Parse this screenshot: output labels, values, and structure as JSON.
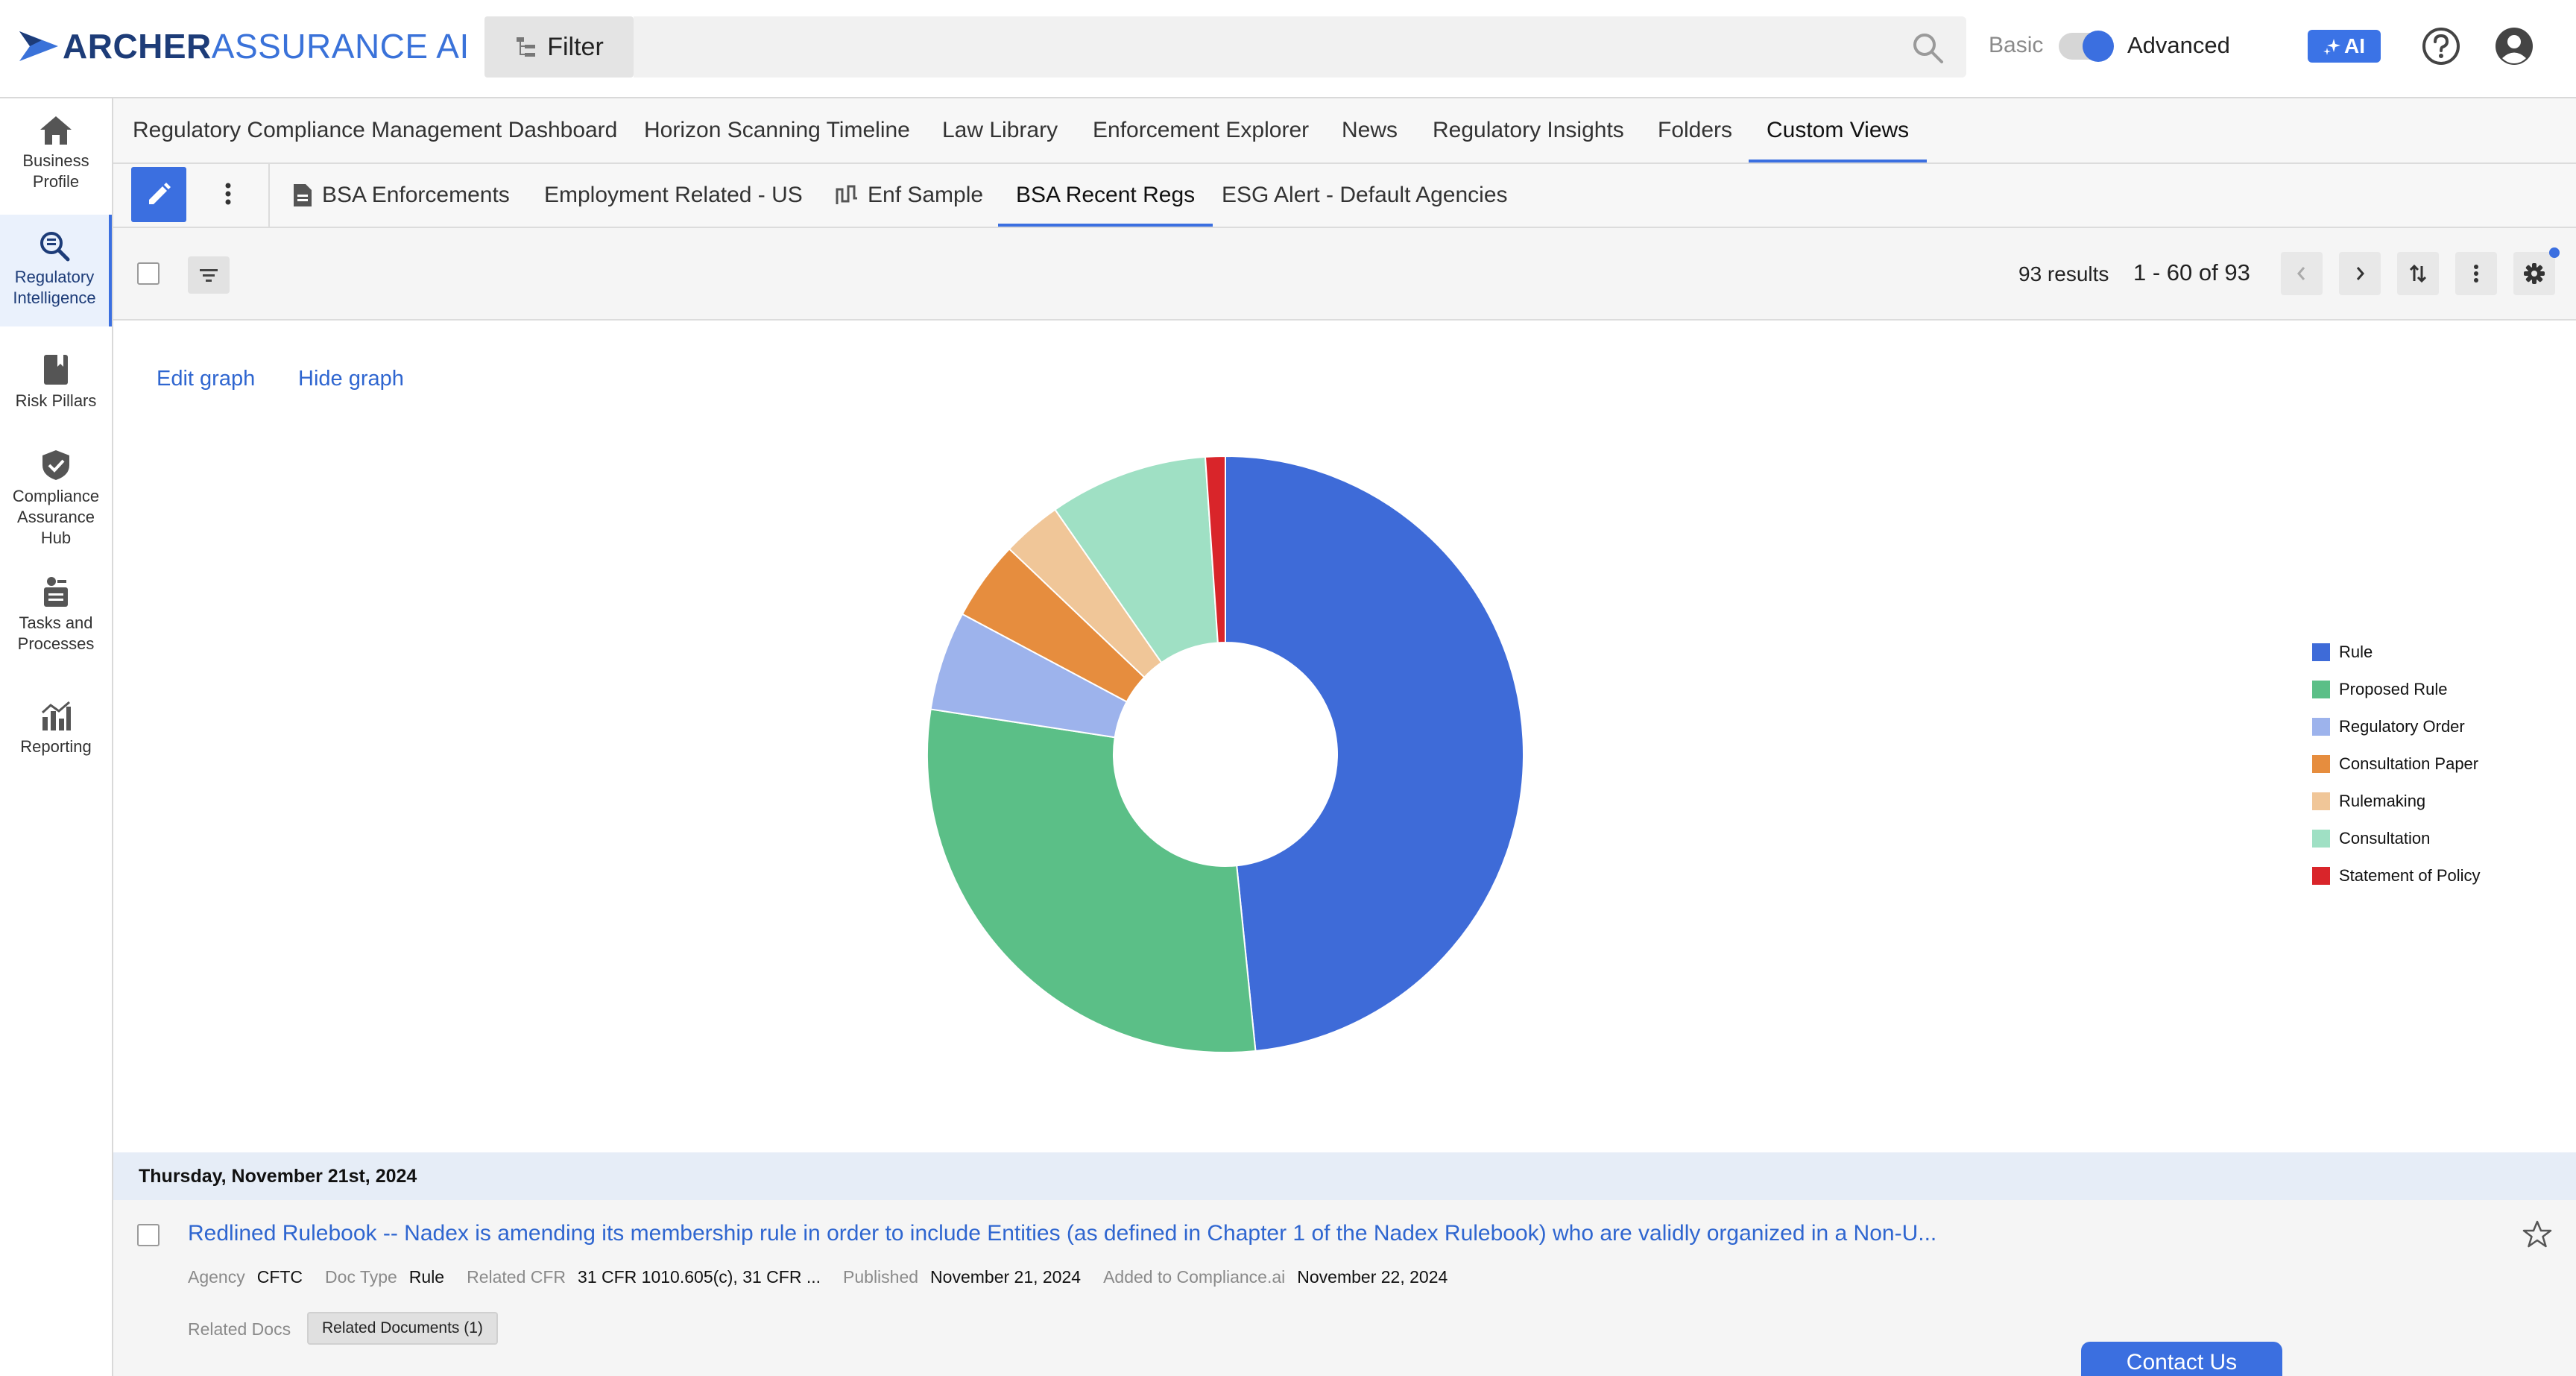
{
  "app": {
    "logo_part1": "ARCHER",
    "logo_part2": "ASSURANCE AI",
    "filter_label": "Filter",
    "search_placeholder": "",
    "mode_basic": "Basic",
    "mode_advanced": "Advanced",
    "ai_label": "AI"
  },
  "sidebar": {
    "items": [
      {
        "label": "Business Profile",
        "icon": "home-icon"
      },
      {
        "label": "Regulatory Intelligence",
        "icon": "search-doc-icon",
        "active": true
      },
      {
        "label": "Risk Pillars",
        "icon": "book-icon"
      },
      {
        "label": "Compliance Assurance Hub",
        "icon": "shield-check-icon"
      },
      {
        "label": "Tasks and Processes",
        "icon": "clipboard-icon"
      },
      {
        "label": "Reporting",
        "icon": "chart-icon"
      }
    ]
  },
  "primary_tabs": [
    {
      "label": "Regulatory Compliance Management Dashboard"
    },
    {
      "label": "Horizon Scanning Timeline"
    },
    {
      "label": "Law Library"
    },
    {
      "label": "Enforcement Explorer"
    },
    {
      "label": "News"
    },
    {
      "label": "Regulatory Insights"
    },
    {
      "label": "Folders"
    },
    {
      "label": "Custom Views",
      "active": true
    }
  ],
  "secondary_tabs": [
    {
      "label": "BSA Enforcements",
      "icon": "document-icon"
    },
    {
      "label": "Employment Related - US"
    },
    {
      "label": "Enf Sample",
      "icon": "timeline-icon"
    },
    {
      "label": "BSA Recent Regs",
      "active": true
    },
    {
      "label": "ESG Alert - Default Agencies"
    }
  ],
  "results": {
    "count_text": "93 results",
    "range_text": "1 - 60 of 93"
  },
  "graph": {
    "edit_label": "Edit graph",
    "hide_label": "Hide graph"
  },
  "chart_data": {
    "type": "pie",
    "donut": true,
    "title": "",
    "legend_position": "right",
    "categories": [
      "Rule",
      "Proposed Rule",
      "Regulatory Order",
      "Consultation Paper",
      "Rulemaking",
      "Consultation",
      "Statement of Policy"
    ],
    "values": [
      45,
      27,
      5,
      4,
      3,
      8,
      1
    ],
    "colors": [
      "#3e6bd8",
      "#5bbf87",
      "#9db3ec",
      "#e68d3e",
      "#f0c698",
      "#9fe0c4",
      "#d9252a"
    ]
  },
  "list": {
    "date_header": "Thursday, November 21st, 2024",
    "rows": [
      {
        "title": "Redlined Rulebook -- Nadex is amending its membership rule in order to include Entities (as defined in Chapter 1 of the Nadex Rulebook) who are validly organized in a Non-U...",
        "agency_label": "Agency",
        "agency": "CFTC",
        "doctype_label": "Doc Type",
        "doctype": "Rule",
        "cfr_label": "Related CFR",
        "cfr": "31 CFR 1010.605(c), 31 CFR ...",
        "published_label": "Published",
        "published": "November 21, 2024",
        "added_label": "Added to Compliance.ai",
        "added": "November 22, 2024",
        "related_docs_label": "Related Docs",
        "related_docs_chip": "Related Documents (1)"
      }
    ]
  },
  "contact_label": "Contact Us"
}
